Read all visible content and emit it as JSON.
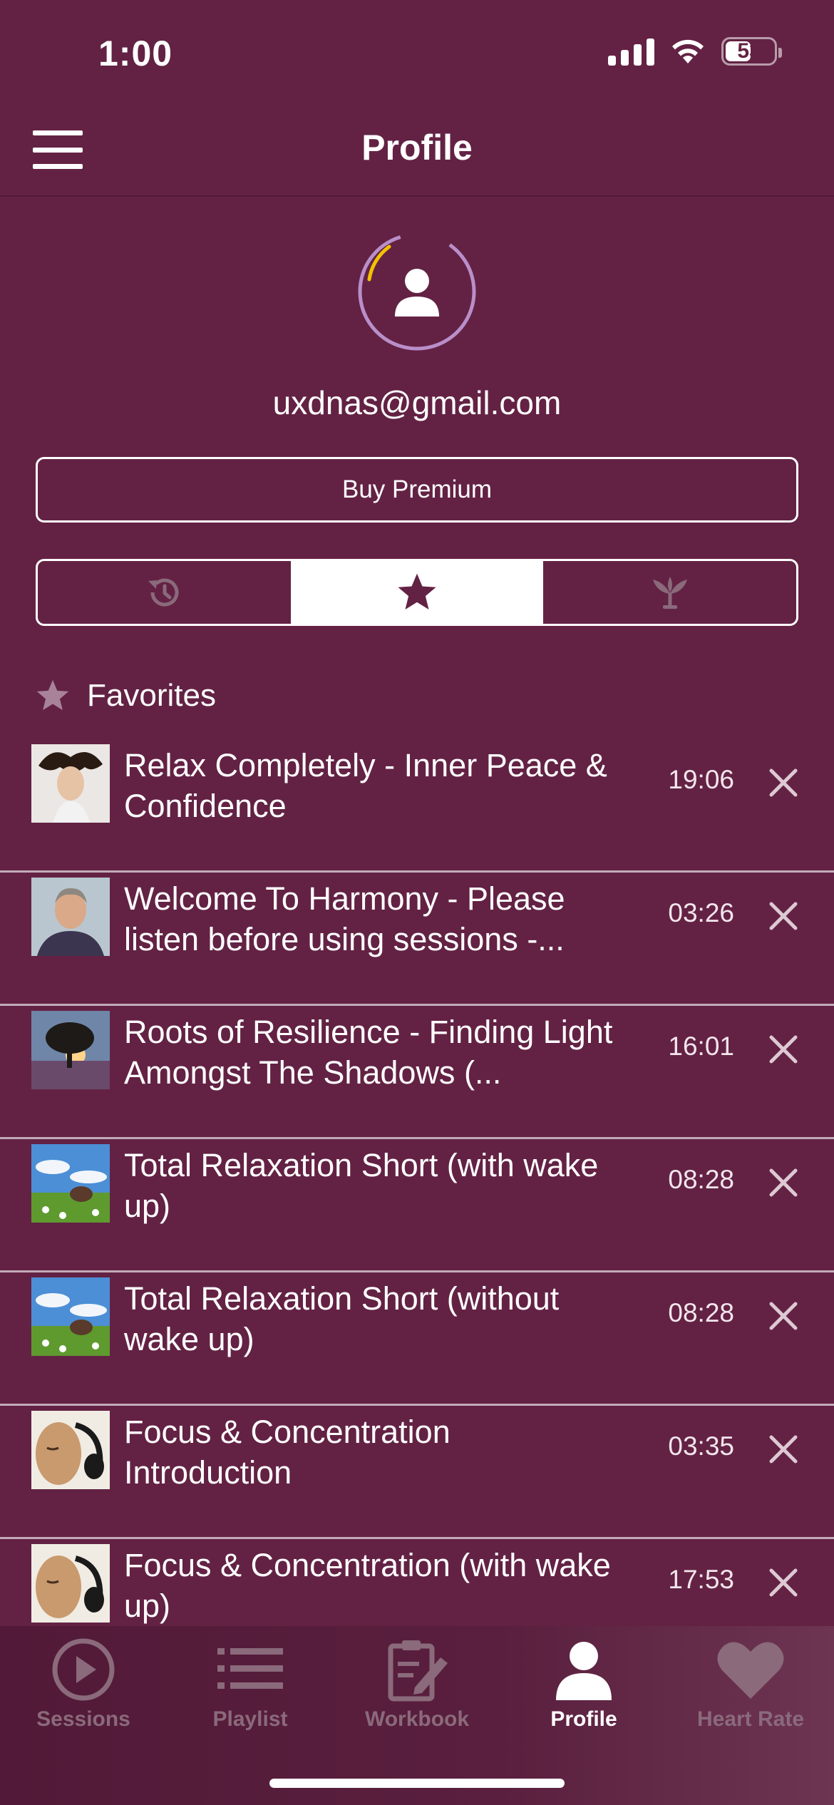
{
  "status_bar": {
    "time": "1:00",
    "battery": "53"
  },
  "header": {
    "title": "Profile"
  },
  "profile": {
    "email": "uxdnas@gmail.com",
    "premium_label": "Buy Premium"
  },
  "segment": {
    "tabs": [
      {
        "icon": "history-icon",
        "active": false
      },
      {
        "icon": "star-icon",
        "active": true
      },
      {
        "icon": "lotus-icon",
        "active": false
      }
    ]
  },
  "favorites": {
    "title": "Favorites",
    "items": [
      {
        "title": "Relax Completely - Inner Peace & Confidence",
        "duration": "19:06",
        "thumb": "woman-hair"
      },
      {
        "title": "Welcome To Harmony - Please listen before using sessions -...",
        "duration": "03:26",
        "thumb": "man-portrait"
      },
      {
        "title": "Roots of Resilience - Finding Light Amongst The Shadows (...",
        "duration": "16:01",
        "thumb": "tree-sunset"
      },
      {
        "title": "Total Relaxation Short (with wake up)",
        "duration": "08:28",
        "thumb": "grass-sky"
      },
      {
        "title": "Total Relaxation Short (without wake up)",
        "duration": "08:28",
        "thumb": "grass-sky"
      },
      {
        "title": "Focus & Concentration Introduction",
        "duration": "03:35",
        "thumb": "headphones-face"
      },
      {
        "title": "Focus & Concentration (with wake up)",
        "duration": "17:53",
        "thumb": "headphones-face"
      }
    ]
  },
  "tab_bar": {
    "items": [
      {
        "label": "Sessions",
        "icon": "play-circle-icon"
      },
      {
        "label": "Playlist",
        "icon": "list-icon"
      },
      {
        "label": "Workbook",
        "icon": "clipboard-edit-icon"
      },
      {
        "label": "Profile",
        "icon": "person-icon",
        "active": true
      },
      {
        "label": "Heart Rate",
        "icon": "heart-icon"
      }
    ]
  },
  "colors": {
    "background": "#632244",
    "tab_inactive": "#8a6a7b",
    "avatar_ring": "#b98fc9",
    "avatar_accent": "#f2c200"
  }
}
